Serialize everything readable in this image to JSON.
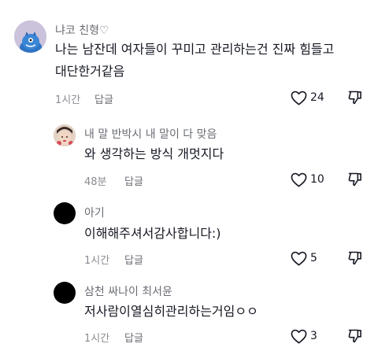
{
  "comments": [
    {
      "username": "냐코 친형♡",
      "text_line1": "나는 남잔데 여자들이 꾸미고 관리하는건 진짜 힘들고",
      "text_line2": "대단한거같음",
      "time": "1시간",
      "reply_label": "답글",
      "likes": "24",
      "avatar_icon": "blue-monster-avatar"
    },
    {
      "username": "내 말 반박시 내 말이 다 맞음",
      "text_line1": "와 생각하는 방식 개멋지다",
      "time": "48분",
      "reply_label": "답글",
      "likes": "10",
      "avatar_icon": "photo-avatar"
    },
    {
      "username": "아기",
      "text_line1": "이해해주셔서감사합니다:)",
      "time": "1시간",
      "reply_label": "답글",
      "likes": "5",
      "avatar_icon": "black-avatar"
    },
    {
      "username": "삼천 싸나이 최서윤",
      "text_line1": "저사람이열심히관리하는거임ㅇㅇ",
      "time": "1시간",
      "reply_label": "답글",
      "likes": "3",
      "avatar_icon": "black-avatar"
    }
  ]
}
